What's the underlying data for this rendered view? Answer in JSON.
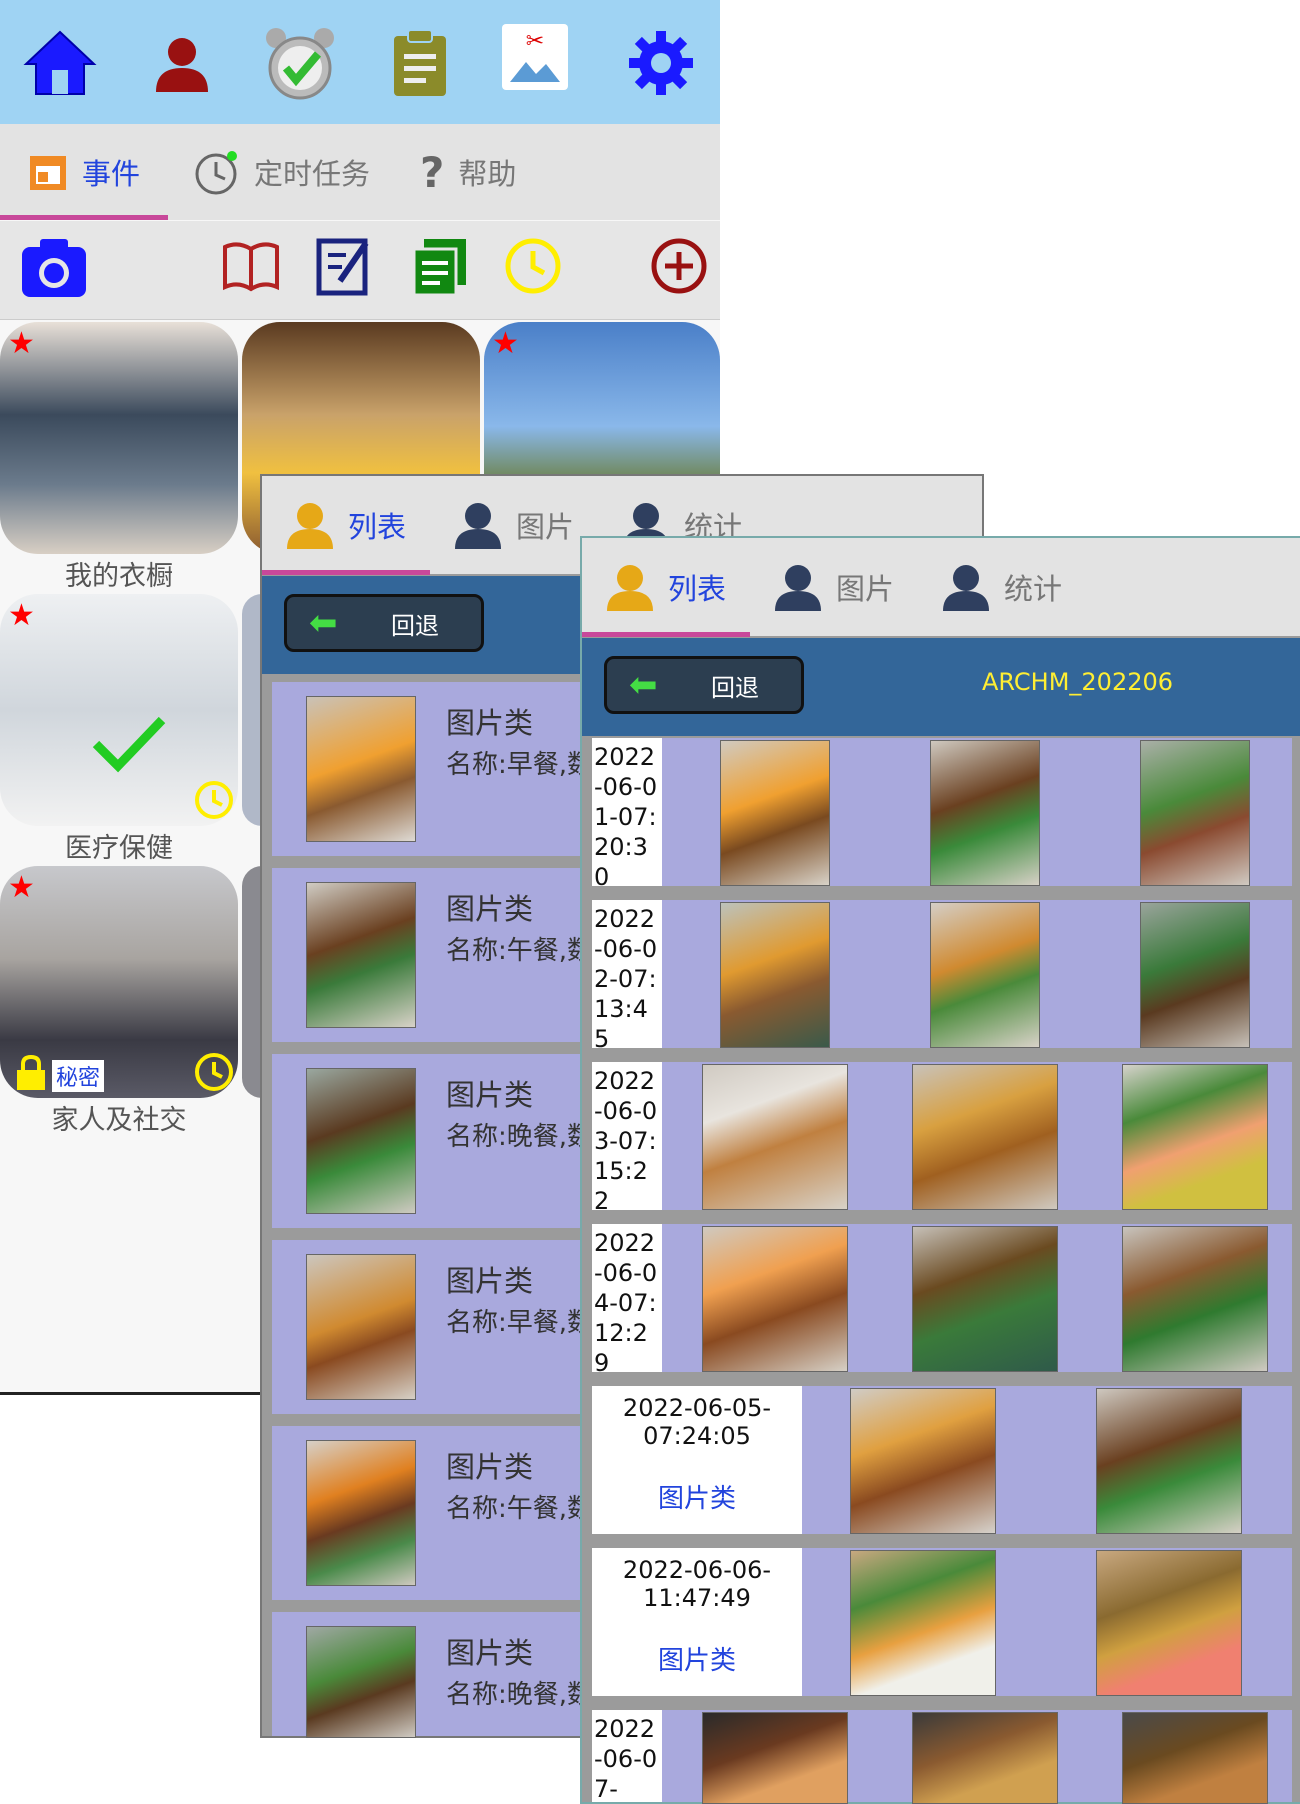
{
  "panel1": {
    "tabs": [
      {
        "label": "事件",
        "icon": "calendar-icon",
        "active": true
      },
      {
        "label": "定时任务",
        "icon": "alarm-clock-icon"
      },
      {
        "label": "帮助",
        "icon": "question-icon"
      }
    ],
    "categories": [
      {
        "label": "我的衣橱",
        "starred": true
      },
      {
        "label": "医疗保健",
        "starred": true
      },
      {
        "label": "家人及社交",
        "starred": true,
        "secret_badge": "秘密"
      }
    ],
    "colors": {
      "topbar": "#9fd3f3",
      "accent_star": "#ff0000",
      "tab_underline": "#c8489a"
    }
  },
  "panel2": {
    "tabs": [
      "列表",
      "图片",
      "统计"
    ],
    "back_label": "回退",
    "cards": [
      {
        "title": "图片类",
        "name": "名称:早餐,数"
      },
      {
        "title": "图片类",
        "name": "名称:午餐,数"
      },
      {
        "title": "图片类",
        "name": "名称:晚餐,数"
      },
      {
        "title": "图片类",
        "name": "名称:早餐,数"
      },
      {
        "title": "图片类",
        "name": "名称:午餐,数"
      },
      {
        "title": "图片类",
        "name": "名称:晚餐,数"
      }
    ]
  },
  "panel3": {
    "tabs": [
      "列表",
      "图片",
      "统计"
    ],
    "back_label": "回退",
    "archive_title": "ARCHM_202206",
    "rows": [
      {
        "date": "2022-06-01-07:20:30",
        "images": 3
      },
      {
        "date": "2022-06-02-07:13:45",
        "images": 3
      },
      {
        "date": "2022-06-03-07:15:22",
        "images": 3
      },
      {
        "date": "2022-06-04-07:12:29",
        "images": 3
      },
      {
        "date_line1": "2022-06-05-",
        "date_line2": "07:24:05",
        "category": "图片类",
        "images": 2
      },
      {
        "date_line1": "2022-06-06-",
        "date_line2": "11:47:49",
        "category": "图片类",
        "images": 2
      },
      {
        "date": "2022-06-07-",
        "images": 3
      }
    ]
  }
}
